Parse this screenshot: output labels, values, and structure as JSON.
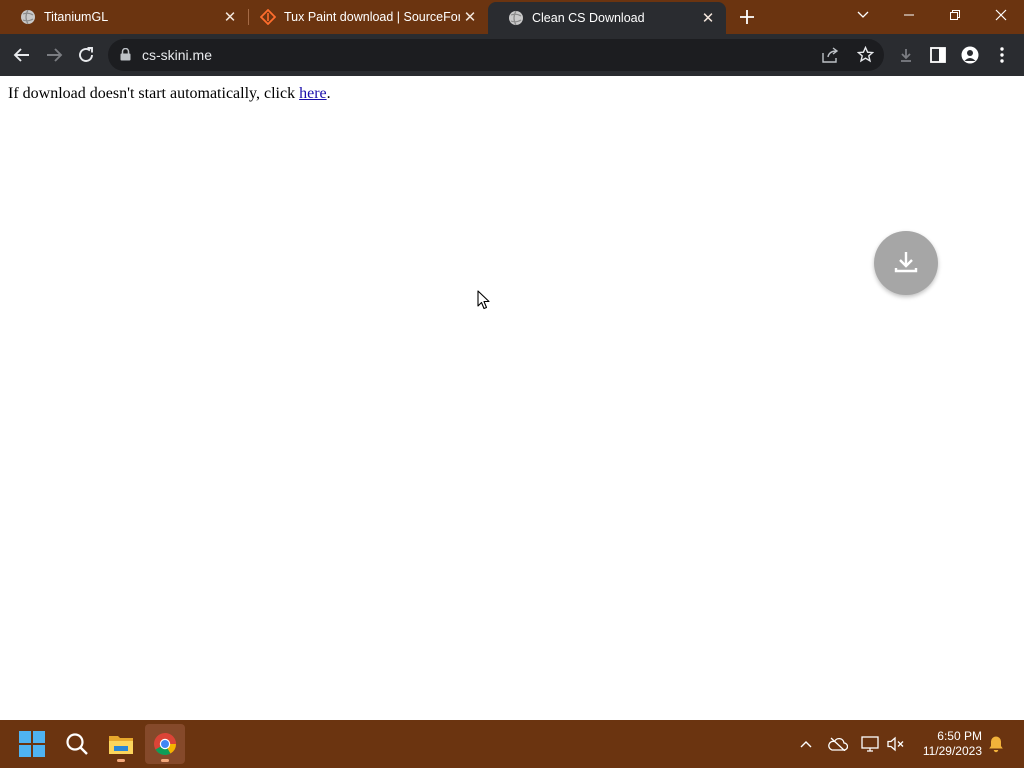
{
  "browser": {
    "tabs": [
      {
        "title": "TitaniumGL",
        "favicon": "globe-icon",
        "active": false
      },
      {
        "title": "Tux Paint download | SourceForge",
        "favicon": "sourceforge-icon",
        "active": false
      },
      {
        "title": "Clean CS Download",
        "favicon": "globe-icon",
        "active": true
      }
    ],
    "address": {
      "url": "cs-skini.me"
    }
  },
  "page": {
    "message_prefix": "If download doesn't start automatically, click ",
    "link_text": "here",
    "message_suffix": "."
  },
  "taskbar": {
    "apps": [
      {
        "name": "start",
        "icon": "windows-logo-icon"
      },
      {
        "name": "search",
        "icon": "search-icon"
      },
      {
        "name": "file-explorer",
        "icon": "folder-icon"
      },
      {
        "name": "chrome",
        "icon": "chrome-icon",
        "active": true
      }
    ],
    "clock": {
      "time": "6:50 PM",
      "date": "11/29/2023"
    }
  },
  "colors": {
    "frame": "#6b3410",
    "toolbar": "#2a2c30",
    "omnibox": "#1c1d20",
    "link": "#1a0dab",
    "fab": "#a6a6a6"
  }
}
